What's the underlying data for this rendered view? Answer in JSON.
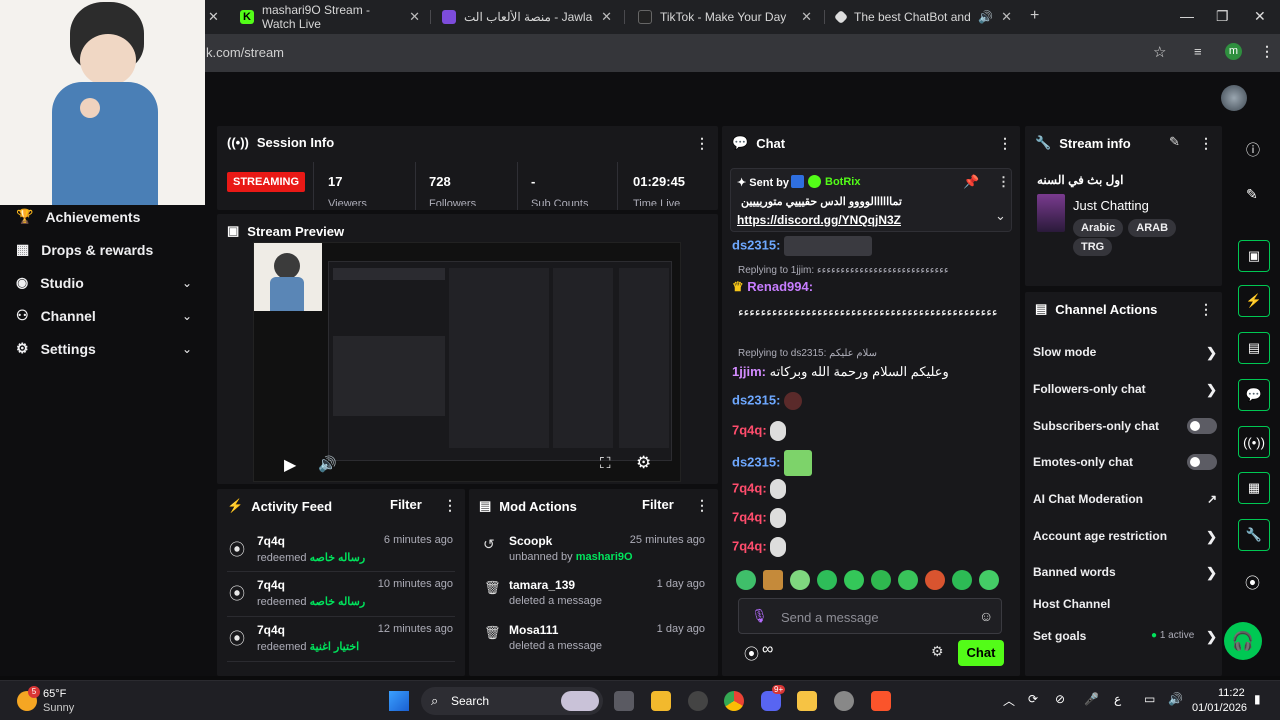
{
  "browser": {
    "tabs": [
      {
        "title": "mashari9O Stream - Watch Live",
        "color": "#53fc18"
      },
      {
        "title": "منصة الألعاب الت - Jawlah | جولة",
        "color": "#b07cff"
      },
      {
        "title": "TikTok - Make Your Day",
        "color": "#000000"
      },
      {
        "title": "The best ChatBot and Widg",
        "color": "#ffffff"
      }
    ],
    "url": "k.com/stream",
    "profile_initial": "m"
  },
  "sidebar": {
    "items": [
      {
        "label": "Achievements",
        "icon": "trophy-icon",
        "chevron": false
      },
      {
        "label": "Drops & rewards",
        "icon": "drops-icon",
        "chevron": false
      },
      {
        "label": "Studio",
        "icon": "studio-icon",
        "chevron": true
      },
      {
        "label": "Channel",
        "icon": "channel-icon",
        "chevron": true
      },
      {
        "label": "Settings",
        "icon": "gear-icon",
        "chevron": true
      }
    ]
  },
  "session": {
    "title": "Session Info",
    "badge": "STREAMING",
    "stats": [
      {
        "value": "17",
        "label": "Viewers"
      },
      {
        "value": "728",
        "label": "Followers"
      },
      {
        "value": "-",
        "label": "Sub Counts"
      },
      {
        "value": "01:29:45",
        "label": "Time Live"
      }
    ]
  },
  "preview": {
    "title": "Stream Preview"
  },
  "activity": {
    "title": "Activity Feed",
    "filter": "Filter",
    "rows": [
      {
        "name": "7q4q",
        "action": "redeemed",
        "detail": "رساله خاصه",
        "time": "6 minutes ago"
      },
      {
        "name": "7q4q",
        "action": "redeemed",
        "detail": "رساله خاصه",
        "time": "10 minutes ago"
      },
      {
        "name": "7q4q",
        "action": "redeemed",
        "detail": "اختيار اغنية",
        "time": "12 minutes ago"
      }
    ]
  },
  "mod": {
    "title": "Mod Actions",
    "filter": "Filter",
    "rows": [
      {
        "name": "Scoopk",
        "action": "unbanned by",
        "by": "mashari9O",
        "time": "25 minutes ago",
        "icon": "undo-icon"
      },
      {
        "name": "tamara_139",
        "action": "deleted a message",
        "by": "",
        "time": "1 day ago",
        "icon": "trash-icon"
      },
      {
        "name": "Mosa111",
        "action": "deleted a message",
        "by": "",
        "time": "1 day ago",
        "icon": "trash-icon"
      }
    ]
  },
  "chat": {
    "title": "Chat",
    "pinned": {
      "sent_by": "Sent by",
      "bot": "BotRix",
      "text": "تماااااالوووو الدس حقيييي متوريييين",
      "link": "https://discord.gg/YNQqjN3Z"
    },
    "messages": [
      {
        "user": "ds2315:",
        "color": "#6ea8ff",
        "reply": "",
        "text": ""
      },
      {
        "user": "Renad994:",
        "color": "#c77dff",
        "reply": "Replying to 1jjim: ﺀﺀﺀﺀﺀﺀﺀﺀﺀﺀﺀﺀﺀﺀﺀﺀﺀﺀﺀﺀﺀﺀﺀﺀﺀﺀﺀﺀ",
        "text": "ﺀﺀﺀﺀﺀﺀﺀﺀﺀﺀﺀﺀﺀﺀﺀﺀﺀﺀﺀﺀﺀﺀﺀﺀﺀﺀﺀﺀﺀﺀﺀﺀﺀﺀﺀﺀﺀﺀﺀﺀﺀﺀﺀﺀﺀﺀ"
      },
      {
        "user": "1jjim:",
        "color": "#d38cff",
        "reply": "Replying to ds2315: سلام عليكم",
        "text": "وعليكم السلام ورحمة الله وبركاته"
      },
      {
        "user": "ds2315:",
        "color": "#6ea8ff",
        "reply": "",
        "text": ""
      },
      {
        "user": "7q4q:",
        "color": "#ff4d6d",
        "reply": "",
        "text": ""
      },
      {
        "user": "ds2315:",
        "color": "#6ea8ff",
        "reply": "",
        "text": ""
      },
      {
        "user": "7q4q:",
        "color": "#ff4d6d",
        "reply": "",
        "text": ""
      },
      {
        "user": "7q4q:",
        "color": "#ff4d6d",
        "reply": "",
        "text": ""
      },
      {
        "user": "7q4q:",
        "color": "#ff4d6d",
        "reply": "",
        "text": ""
      }
    ],
    "input_placeholder": "Send a message",
    "send_label": "Chat"
  },
  "stream_info": {
    "title": "Stream info",
    "stream_title": "اول بث في السنه",
    "category": "Just Chatting",
    "tags": [
      "Arabic",
      "ARAB",
      "TRG"
    ]
  },
  "channel_actions": {
    "title": "Channel Actions",
    "items": [
      {
        "label": "Slow mode",
        "type": "arrow"
      },
      {
        "label": "Followers-only chat",
        "type": "arrow"
      },
      {
        "label": "Subscribers-only chat",
        "type": "toggle"
      },
      {
        "label": "Emotes-only chat",
        "type": "toggle"
      },
      {
        "label": "AI Chat Moderation",
        "type": "external"
      },
      {
        "label": "Account age restriction",
        "type": "arrow"
      },
      {
        "label": "Banned words",
        "type": "arrow"
      },
      {
        "label": "Host Channel",
        "type": "none"
      },
      {
        "label": "Set goals",
        "type": "arrow"
      }
    ],
    "goals_status": "1 active"
  },
  "taskbar": {
    "weather_temp": "65°F",
    "weather_desc": "Sunny",
    "weather_badge": "5",
    "search_label": "Search",
    "clock_time": "11:22",
    "clock_date": "01/01/2026",
    "discord_badge": "9+",
    "lang": "ع"
  },
  "colors": {
    "accent": "#53fc18",
    "streaming_badge": "#e91916",
    "panel_bg": "#18181b"
  }
}
